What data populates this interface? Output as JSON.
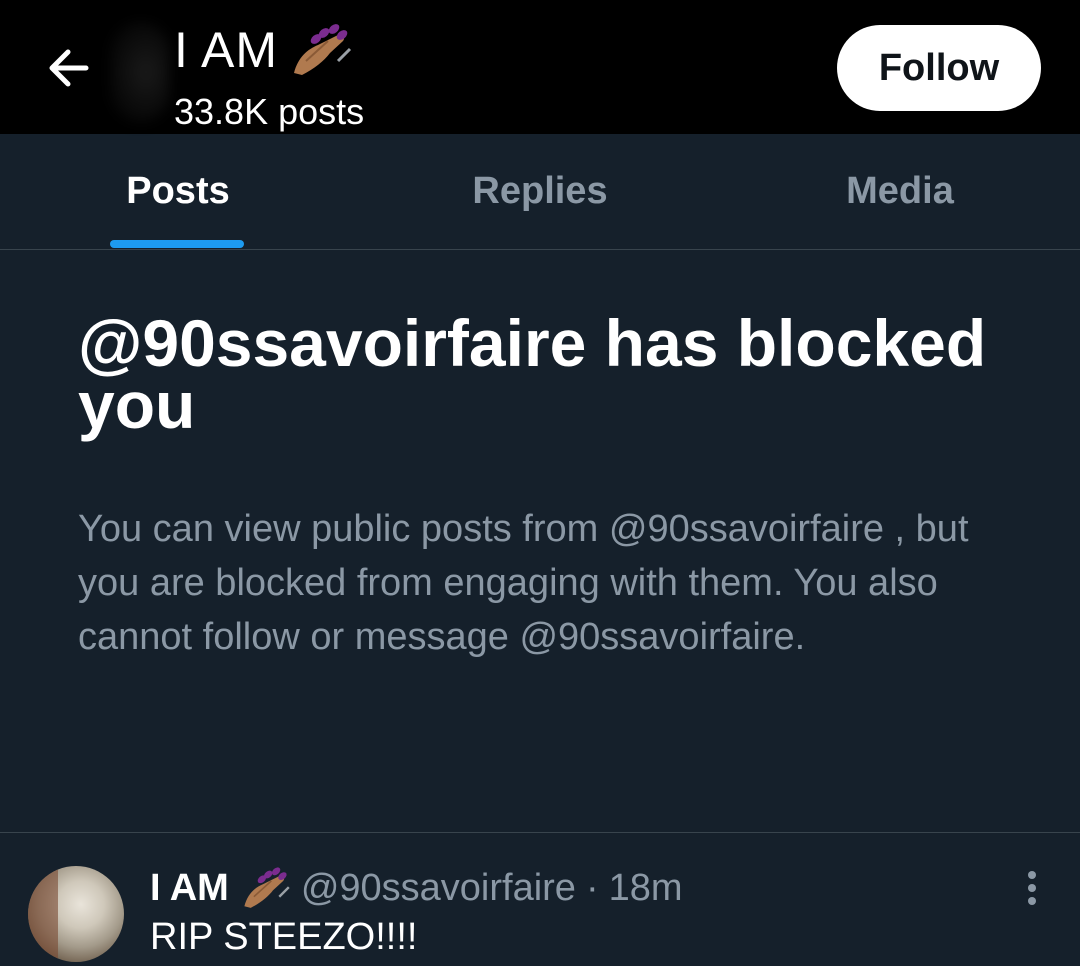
{
  "header": {
    "display_name": "I AM",
    "name_emoji_icon": "painting-nails-emoji-icon",
    "post_count": "33.8K posts",
    "follow_label": "Follow",
    "back_icon": "arrow-left-icon"
  },
  "tabs": [
    {
      "label": "Posts",
      "active": true
    },
    {
      "label": "Replies",
      "active": false
    },
    {
      "label": "Media",
      "active": false
    }
  ],
  "blocked": {
    "title": "@90ssavoirfaire has blocked you",
    "description": "You can view public posts from @90ssavoirfaire , but you are blocked from engaging with them. You also cannot follow or message @90ssavoirfaire."
  },
  "post": {
    "display_name": "I AM",
    "handle": "@90ssavoirfaire",
    "separator": "·",
    "time": "18m",
    "text": "RIP STEEZO!!!!",
    "more_icon": "more-vertical-icon"
  },
  "colors": {
    "background": "#15202b",
    "header_background": "#000000",
    "accent": "#1d9bf0",
    "secondary_text": "#8b98a5",
    "divider": "#38444d"
  }
}
